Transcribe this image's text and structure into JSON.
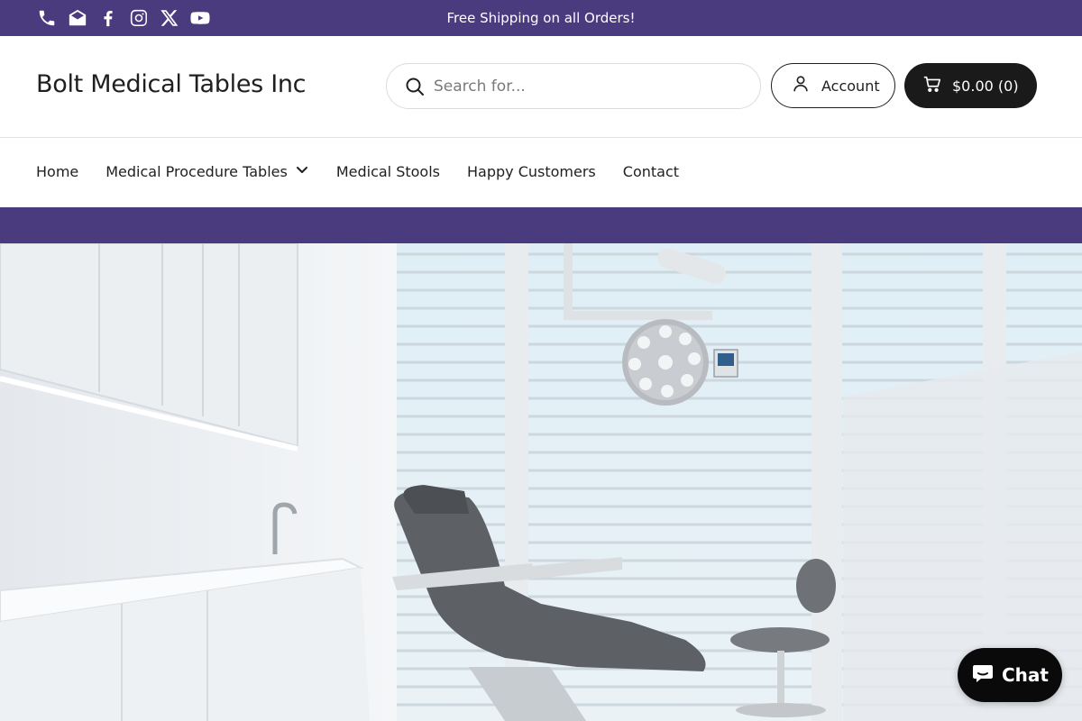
{
  "announcement": {
    "text": "Free Shipping on all Orders!",
    "social_icons": [
      "phone-icon",
      "email-icon",
      "facebook-icon",
      "instagram-icon",
      "x-icon",
      "youtube-icon"
    ]
  },
  "header": {
    "logo": "Bolt Medical Tables Inc",
    "search_placeholder": "Search for...",
    "account_label": "Account",
    "cart_label": "$0.00 (0)"
  },
  "nav": {
    "items": [
      {
        "label": "Home"
      },
      {
        "label": "Medical Procedure Tables",
        "dropdown": true
      },
      {
        "label": "Medical Stools"
      },
      {
        "label": "Happy Customers"
      },
      {
        "label": "Contact"
      }
    ]
  },
  "chat": {
    "label": "Chat"
  },
  "colors": {
    "brand_purple": "#4a3a7e",
    "dark": "#1a1a1a"
  }
}
